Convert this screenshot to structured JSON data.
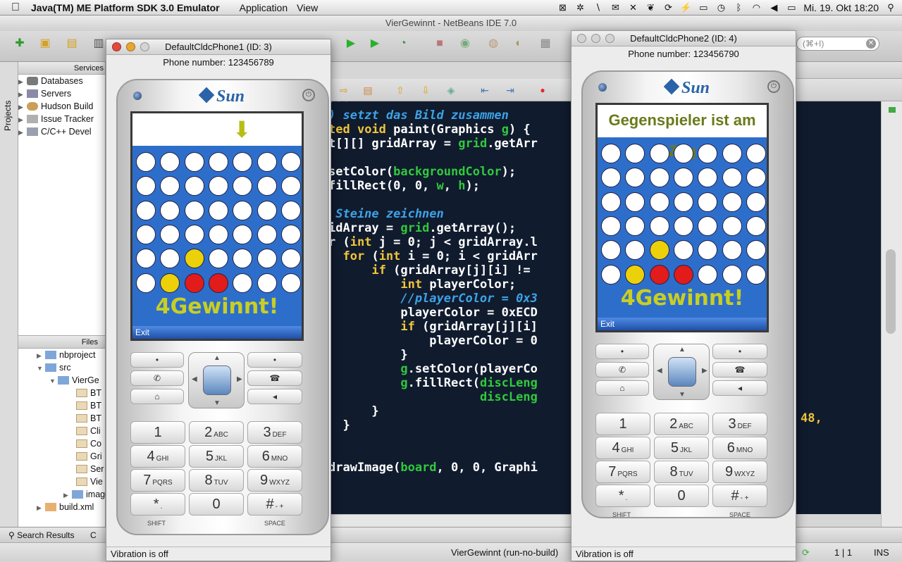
{
  "menubar": {
    "app_name": "Java(TM) ME Platform SDK 3.0 Emulator",
    "menus": [
      "Application",
      "View"
    ],
    "clock": "Mi. 19. Okt  18:20"
  },
  "netbeans": {
    "window_title": "VierGewinnt - NetBeans IDE 7.0",
    "search_placeholder": "(⌘+I)",
    "services_header": "Services",
    "services_items": [
      "Databases",
      "Servers",
      "Hudson Build",
      "Issue Tracker",
      "C/C++ Devel"
    ],
    "projects_tab": "Projects",
    "files_header": "Files",
    "files_items": [
      "nbproject",
      "src",
      "VierGe",
      "BT",
      "BT",
      "BT",
      "Cli",
      "Co",
      "Gri",
      "Ser",
      "Vie",
      "images",
      "build.xml"
    ],
    "bottom_tabs": [
      "Search Results",
      "C"
    ],
    "status_left": "VierGewinnt (run-no-build)",
    "status_pos": "1 | 1",
    "status_mode": "INS",
    "code_lines": [
      {
        "t": "/**",
        "cls": "cm"
      },
      {
        "t": ") setzt das Bild zusammen",
        "cls": "cm"
      },
      {
        "t": "ted void paint(Graphics g) {",
        "cls": "mix1"
      },
      {
        "t": "t[][] gridArray = grid.getArr",
        "cls": "mix2"
      },
      {
        "t": "",
        "cls": ""
      },
      {
        "t": "setColor(backgroundColor);",
        "cls": "mix3"
      },
      {
        "t": "fillRect(0, 0, w, h);",
        "cls": "mix4"
      },
      {
        "t": "",
        "cls": ""
      },
      {
        "t": " Steine zeichnen",
        "cls": "cm"
      },
      {
        "t": "idArray = grid.getArray();",
        "cls": "mix5"
      },
      {
        "t": "r (int j = 0; j < gridArray.l",
        "cls": "mix6"
      },
      {
        "t": "  for (int i = 0; i < gridArr",
        "cls": "mix7"
      },
      {
        "t": "      if (gridArray[j][i] !=",
        "cls": "mix8"
      },
      {
        "t": "          int playerColor;",
        "cls": "mix9"
      },
      {
        "t": "          //playerColor = 0x3",
        "cls": "cm"
      },
      {
        "t": "          playerColor = 0xECD",
        "cls": "mix10"
      },
      {
        "t": "          if (gridArray[j][i]",
        "cls": "mix11"
      },
      {
        "t": "              playerColor = 0",
        "cls": "mix12"
      },
      {
        "t": "          }",
        "cls": ""
      },
      {
        "t": "          g.setColor(playerCo",
        "cls": "mix13"
      },
      {
        "t": "          g.fillRect(discLeng",
        "cls": "mix14"
      },
      {
        "t": "                     discLeng",
        "cls": "mix15"
      },
      {
        "t": "      }",
        "cls": ""
      },
      {
        "t": "  }",
        "cls": ""
      },
      {
        "t": "",
        "cls": ""
      },
      {
        "t": "",
        "cls": ""
      },
      {
        "t": "drawImage(board, 0, 0, Graphi",
        "cls": "mix16"
      }
    ],
    "code_right": "48,"
  },
  "phone1": {
    "window_title": "DefaultCldcPhone1 (ID: 3)",
    "phone_number": "Phone number: 123456789",
    "brand": "Sun",
    "status_text": "",
    "wordmark": "4Gewinnt!",
    "softkey": "Exit",
    "vibration": "Vibration is off",
    "arrow_column": 4,
    "board": [
      "wwwwwww",
      "wwwwwww",
      "wwwwwww",
      "wwwwwww",
      "wwywwww",
      "wyrrwww"
    ]
  },
  "phone2": {
    "window_title": "DefaultCldcPhone2 (ID: 4)",
    "phone_number": "Phone number: 123456790",
    "brand": "Sun",
    "status_text": "Gegenspieler ist am Zug",
    "wordmark": "4Gewinnt!",
    "softkey": "Exit",
    "vibration": "Vibration is off",
    "board": [
      "wwwwwww",
      "wwwwwww",
      "wwwwwww",
      "wwwwwww",
      "wwywwww",
      "wyrrwww"
    ]
  },
  "keypad": {
    "keys": [
      {
        "n": "1",
        "s": ""
      },
      {
        "n": "2",
        "s": "ABC"
      },
      {
        "n": "3",
        "s": "DEF"
      },
      {
        "n": "4",
        "s": "GHI"
      },
      {
        "n": "5",
        "s": "JKL"
      },
      {
        "n": "6",
        "s": "MNO"
      },
      {
        "n": "7",
        "s": "PQRS"
      },
      {
        "n": "8",
        "s": "TUV"
      },
      {
        "n": "9",
        "s": "WXYZ"
      },
      {
        "n": "*",
        "s": "."
      },
      {
        "n": "0",
        "s": ""
      },
      {
        "n": "#",
        "s": "- +"
      }
    ],
    "shift_label": "SHIFT",
    "space_label": "SPACE"
  },
  "colors": {
    "disc_white": "#ffffff",
    "disc_yellow": "#ecd00a",
    "disc_red": "#e21b1b",
    "screen_blue": "#2e6ecb",
    "editor_bg": "#101b2e"
  }
}
